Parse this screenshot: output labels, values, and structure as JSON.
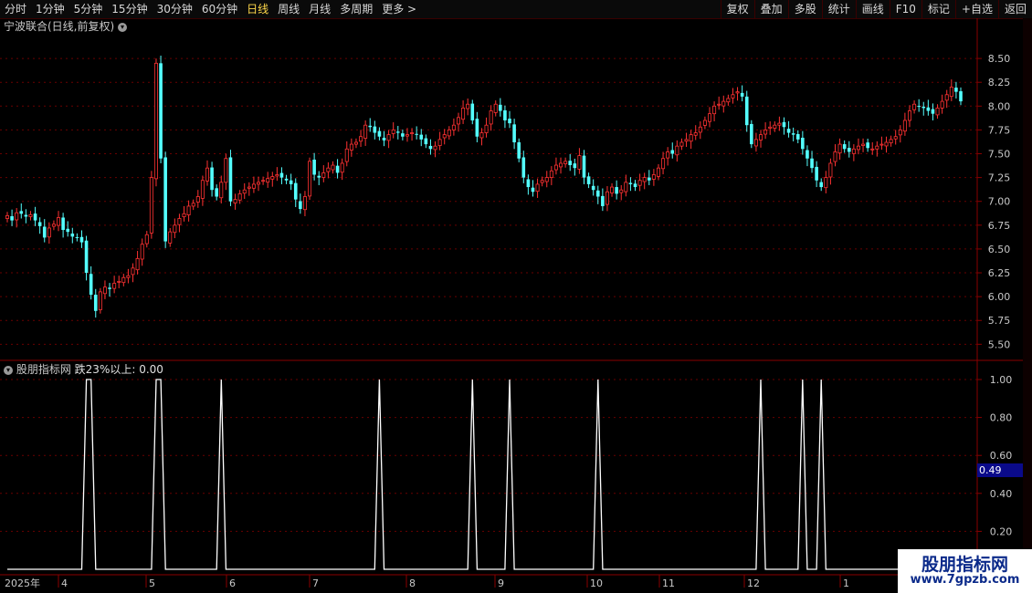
{
  "toolbar": {
    "periods": [
      "分时",
      "1分钟",
      "5分钟",
      "15分钟",
      "30分钟",
      "60分钟",
      "日线",
      "周线",
      "月线",
      "多周期",
      "更多 >"
    ],
    "active_period": "日线",
    "actions": [
      "复权",
      "叠加",
      "多股",
      "统计",
      "画线",
      "F10",
      "标记",
      "+自选",
      "返回"
    ]
  },
  "main_chart": {
    "title": "宁波联合(日线,前复权)",
    "y_ticks": [
      "8.50",
      "8.25",
      "8.00",
      "7.75",
      "7.50",
      "7.25",
      "7.00",
      "6.75",
      "6.50",
      "6.25",
      "6.00",
      "5.75",
      "5.50"
    ],
    "ylim": [
      5.35,
      8.75
    ],
    "up_color": "#ff3232",
    "down_color": "#54ffff"
  },
  "indicator": {
    "title": "股朋指标网",
    "series_label": "跌23%以上: 0.00",
    "y_ticks": [
      "1.00",
      "0.80",
      "0.60",
      "0.40",
      "0.20"
    ],
    "current_badge": "0.49",
    "line_color": "#ffffff"
  },
  "date_axis": {
    "labels": [
      "2025年",
      "4",
      "5",
      "6",
      "7",
      "8",
      "9",
      "10",
      "11",
      "12",
      "1"
    ]
  },
  "watermark": {
    "title": "股朋指标网",
    "url": "www.7gpzb.com"
  },
  "chart_data": {
    "type": "candlestick",
    "title": "宁波联合(日线,前复权)",
    "closes": [
      6.85,
      6.8,
      6.88,
      6.87,
      6.84,
      6.86,
      6.8,
      6.74,
      6.62,
      6.72,
      6.76,
      6.83,
      6.7,
      6.68,
      6.63,
      6.62,
      6.57,
      6.25,
      6.02,
      5.85,
      6.05,
      6.1,
      6.08,
      6.14,
      6.16,
      6.2,
      6.22,
      6.3,
      6.4,
      6.55,
      6.65,
      7.25,
      8.45,
      7.45,
      6.58,
      6.68,
      6.75,
      6.82,
      6.87,
      6.95,
      6.98,
      7.05,
      7.22,
      7.35,
      7.12,
      7.05,
      7.2,
      7.45,
      7.0,
      7.02,
      7.08,
      7.12,
      7.15,
      7.18,
      7.2,
      7.22,
      7.24,
      7.26,
      7.28,
      7.25,
      7.22,
      7.18,
      7.02,
      6.92,
      7.05,
      7.42,
      7.28,
      7.25,
      7.3,
      7.35,
      7.38,
      7.3,
      7.4,
      7.55,
      7.6,
      7.62,
      7.68,
      7.8,
      7.78,
      7.72,
      7.68,
      7.64,
      7.7,
      7.75,
      7.72,
      7.68,
      7.7,
      7.72,
      7.7,
      7.65,
      7.6,
      7.55,
      7.58,
      7.65,
      7.7,
      7.75,
      7.8,
      7.88,
      7.98,
      8.02,
      7.85,
      7.68,
      7.72,
      7.8,
      7.95,
      8.02,
      7.95,
      7.85,
      7.82,
      7.62,
      7.45,
      7.25,
      7.15,
      7.1,
      7.18,
      7.22,
      7.25,
      7.32,
      7.38,
      7.4,
      7.42,
      7.38,
      7.35,
      7.48,
      7.25,
      7.18,
      7.12,
      7.05,
      6.95,
      7.1,
      7.15,
      7.08,
      7.12,
      7.2,
      7.18,
      7.15,
      7.22,
      7.25,
      7.22,
      7.28,
      7.35,
      7.45,
      7.52,
      7.5,
      7.58,
      7.62,
      7.65,
      7.7,
      7.72,
      7.78,
      7.85,
      7.92,
      8.0,
      8.02,
      8.05,
      8.08,
      8.12,
      8.15,
      8.1,
      7.8,
      7.6,
      7.65,
      7.7,
      7.75,
      7.78,
      7.8,
      7.82,
      7.78,
      7.72,
      7.7,
      7.65,
      7.55,
      7.45,
      7.35,
      7.22,
      7.15,
      7.25,
      7.4,
      7.52,
      7.6,
      7.55,
      7.52,
      7.55,
      7.58,
      7.6,
      7.56,
      7.55,
      7.58,
      7.6,
      7.62,
      7.65,
      7.68,
      7.75,
      7.85,
      7.95,
      8.02,
      8.0,
      7.98,
      7.95,
      7.92,
      7.98,
      8.05,
      8.12,
      8.2,
      8.15,
      8.05
    ],
    "signal": [
      0,
      0,
      0,
      0,
      0,
      0,
      0,
      0,
      0,
      0,
      0,
      0,
      0,
      0,
      0,
      0,
      0,
      1,
      1,
      0,
      0,
      0,
      0,
      0,
      0,
      0,
      0,
      0,
      0,
      0,
      0,
      0,
      1,
      1,
      0,
      0,
      0,
      0,
      0,
      0,
      0,
      0,
      0,
      0,
      0,
      0,
      1,
      0,
      0,
      0,
      0,
      0,
      0,
      0,
      0,
      0,
      0,
      0,
      0,
      0,
      0,
      0,
      0,
      0,
      0,
      0,
      0,
      0,
      0,
      0,
      0,
      0,
      0,
      0,
      0,
      0,
      0,
      0,
      0,
      0,
      1,
      0,
      0,
      0,
      0,
      0,
      0,
      0,
      0,
      0,
      0,
      0,
      0,
      0,
      0,
      0,
      0,
      0,
      0,
      0,
      1,
      0,
      0,
      0,
      0,
      0,
      0,
      0,
      1,
      0,
      0,
      0,
      0,
      0,
      0,
      0,
      0,
      0,
      0,
      0,
      0,
      0,
      0,
      0,
      0,
      0,
      0,
      1,
      0,
      0,
      0,
      0,
      0,
      0,
      0,
      0,
      0,
      0,
      0,
      0,
      0,
      0,
      0,
      0,
      0,
      0,
      0,
      0,
      0,
      0,
      0,
      0,
      0,
      0,
      0,
      0,
      0,
      0,
      0,
      0,
      0,
      0,
      1,
      0,
      0,
      0,
      0,
      0,
      0,
      0,
      0,
      1,
      0,
      0,
      0,
      1,
      0,
      0,
      0,
      0,
      0,
      0,
      0,
      0,
      0,
      0,
      0,
      0,
      0,
      0,
      0,
      0,
      0,
      0,
      0,
      0,
      0,
      0,
      0,
      0,
      0,
      0,
      0,
      0,
      0,
      0,
      0,
      0,
      0,
      0,
      0,
      0,
      0,
      0,
      0,
      0,
      0,
      0,
      0,
      0,
      0,
      0
    ]
  }
}
